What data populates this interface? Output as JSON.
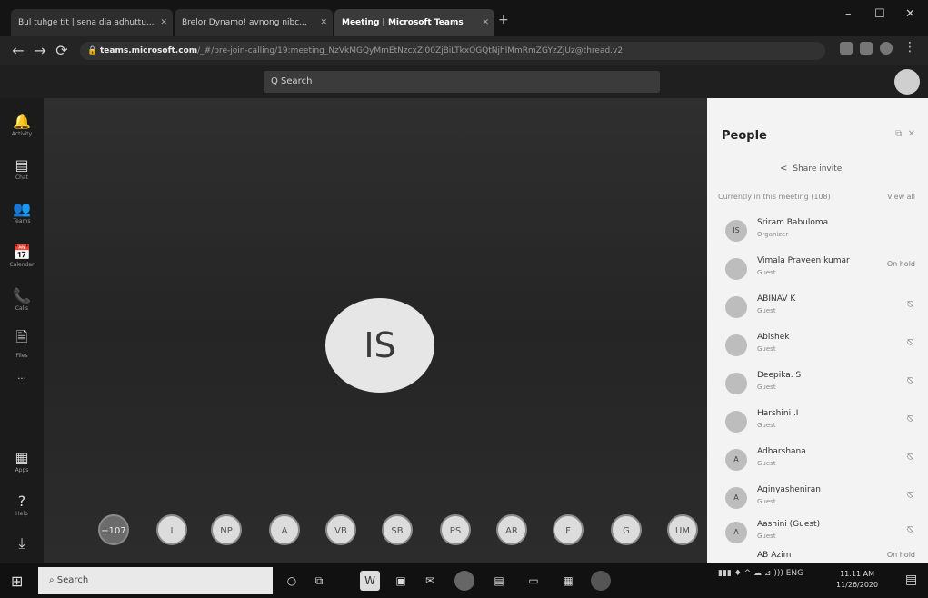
{
  "browser": {
    "tabs": [
      {
        "label": "Bul tuhge tit | sena dia adhuttu...",
        "close": "✕"
      },
      {
        "label": "Brelor Dynamo! avnong nibc...",
        "close": "✕"
      },
      {
        "label": "Meeting | Microsoft Teams",
        "close": "✕"
      }
    ],
    "new_tab": "+",
    "window_controls": {
      "minimize": "–",
      "maximize": "☐",
      "close": "✕"
    },
    "back": "←",
    "forward": "→",
    "reload": "⟳",
    "url_domain": "teams.microsoft.com",
    "url_path": "/_#/pre-join-calling/19:meeting_NzVkMGQyMmEtNzcxZi00ZjBiLTkxOGQtNjhlMmRmZGYzZjUz@thread.v2"
  },
  "teams": {
    "search_placeholder": "Q Search"
  },
  "rail": [
    {
      "icon": "🔔",
      "label": "Activity"
    },
    {
      "icon": "▤",
      "label": "Chat"
    },
    {
      "icon": "👥",
      "label": "Teams"
    },
    {
      "icon": "📅",
      "label": "Calendar"
    },
    {
      "icon": "📞",
      "label": "Calls"
    },
    {
      "icon": "🗎",
      "label": "Files"
    },
    {
      "icon": "···",
      "label": ""
    },
    {
      "icon": "▦",
      "label": "Apps"
    },
    {
      "icon": "?",
      "label": "Help"
    },
    {
      "icon": "⤓",
      "label": ""
    }
  ],
  "stage": {
    "main_initials": "IS",
    "participants": [
      "+107",
      "I",
      "NP",
      "A",
      "VB",
      "SB",
      "PS",
      "AR",
      "F",
      "G",
      "UM"
    ]
  },
  "people": {
    "title": "People",
    "share_invite": "Share invite",
    "section_label": "Currently in this meeting (108)",
    "view_all": "View all",
    "members": [
      {
        "initials": "IS",
        "name": "Sriram Babuloma",
        "role": "Organizer",
        "status": ""
      },
      {
        "initials": "",
        "name": "Vimala Praveen kumar",
        "role": "Guest",
        "status": "On hold"
      },
      {
        "initials": "",
        "name": "ABINAV K",
        "role": "Guest",
        "status": ""
      },
      {
        "initials": "",
        "name": "Abishek",
        "role": "Guest",
        "status": ""
      },
      {
        "initials": "",
        "name": "Deepika. S",
        "role": "Guest",
        "status": ""
      },
      {
        "initials": "",
        "name": "Harshini .I",
        "role": "Guest",
        "status": ""
      },
      {
        "initials": "A",
        "name": "Adharshana",
        "role": "Guest",
        "status": ""
      },
      {
        "initials": "A",
        "name": "Aginyasheniran",
        "role": "Guest",
        "status": ""
      },
      {
        "initials": "A",
        "name": "Aashini (Guest)",
        "role": "Guest",
        "status": ""
      },
      {
        "initials": "",
        "name": "AB Azim",
        "role": "",
        "status": "On hold"
      }
    ]
  },
  "taskbar": {
    "start": "⊞",
    "search_text": "Search",
    "tray": "▮▮▮ ♦ ^ ☁ ⊿ ))) ENG",
    "clock_time": "11:11 AM",
    "clock_date": "11/26/2020",
    "notifications": "▤"
  }
}
